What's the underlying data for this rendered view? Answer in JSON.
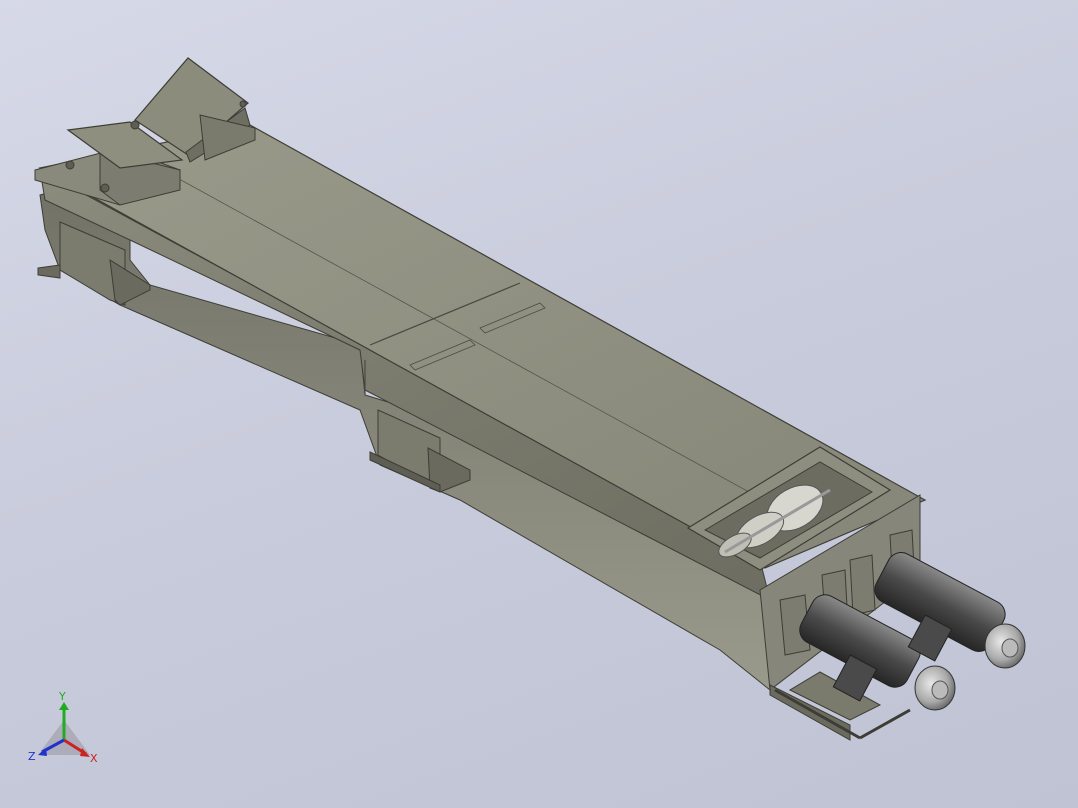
{
  "viewport": {
    "colors": {
      "background_top": "#d6d9e8",
      "background_bottom": "#bfc3d4",
      "body_top": "#8f8f80",
      "body_side": "#86867a",
      "body_dark": "#5e5e54",
      "edge": "#3d3d36"
    }
  },
  "triad": {
    "y_label": "Y",
    "z_label": "Z",
    "x_label": "X",
    "colors": {
      "y": "#22aa22",
      "z": "#2233cc",
      "x": "#cc2222"
    }
  }
}
